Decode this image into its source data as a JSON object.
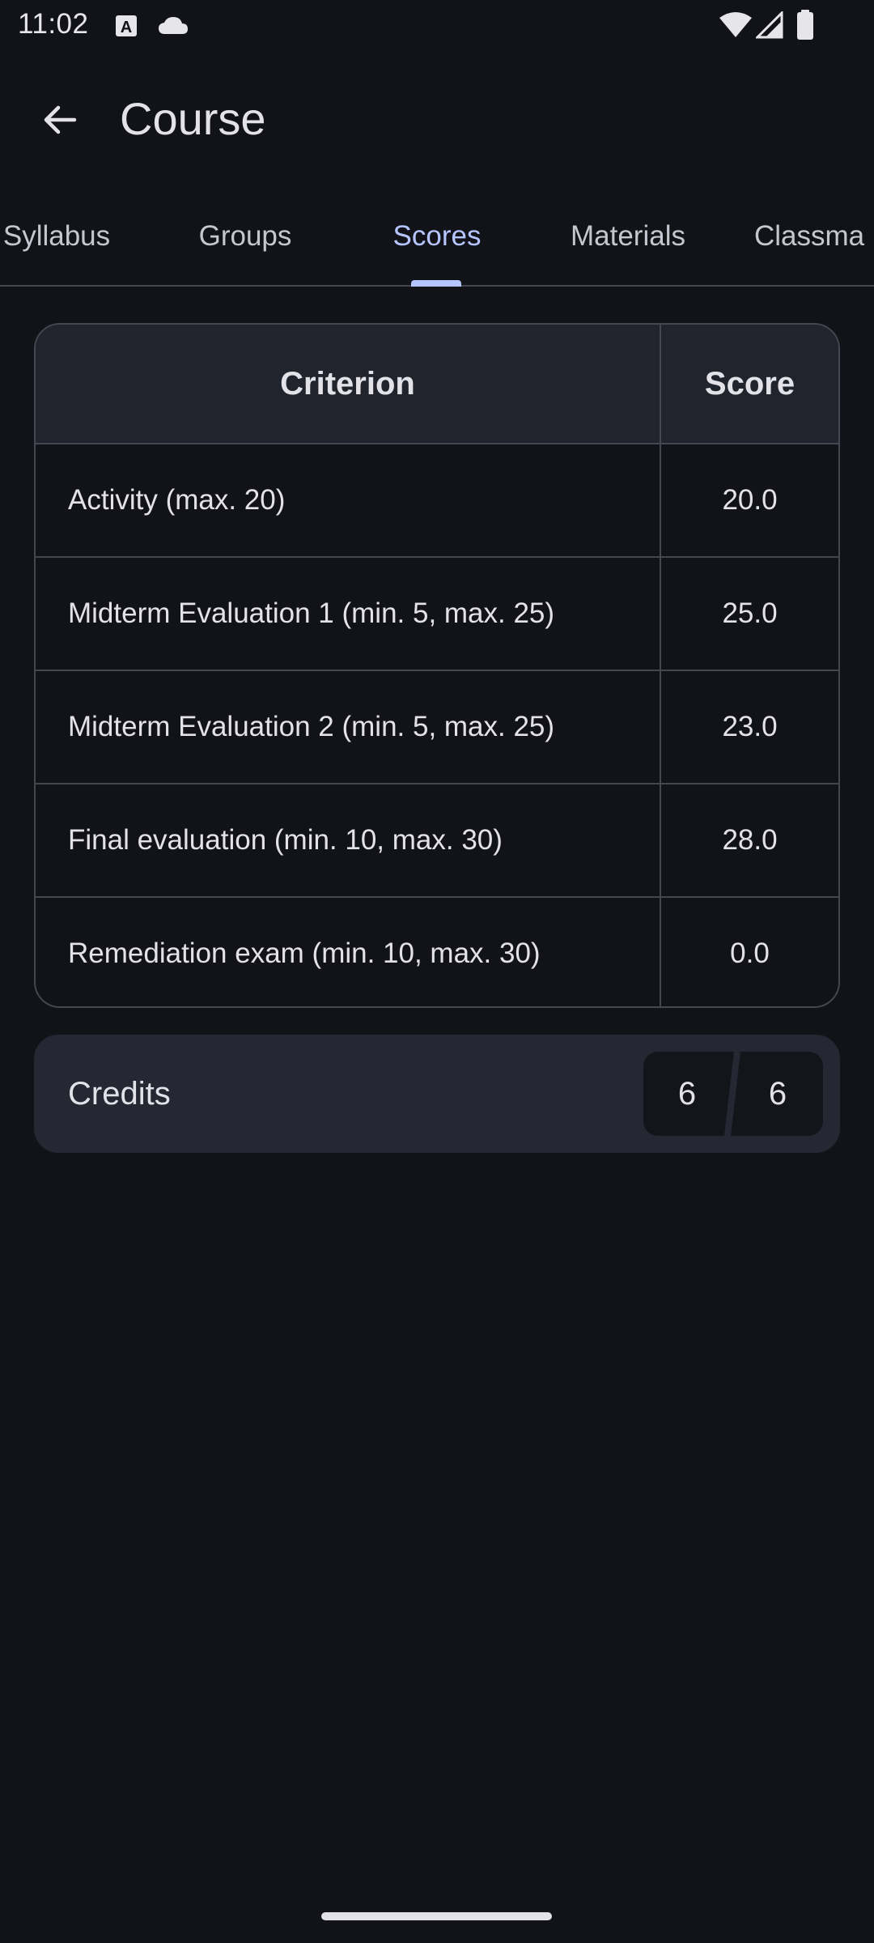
{
  "status_bar": {
    "time": "11:02"
  },
  "app_bar": {
    "title": "Course"
  },
  "tabs": [
    {
      "label": "Syllabus",
      "active": false
    },
    {
      "label": "Groups",
      "active": false
    },
    {
      "label": "Scores",
      "active": true
    },
    {
      "label": "Materials",
      "active": false
    },
    {
      "label": "Classma",
      "active": false
    }
  ],
  "table": {
    "header": {
      "criterion": "Criterion",
      "score": "Score"
    },
    "rows": [
      {
        "criterion": "Activity (max. 20)",
        "score": "20.0"
      },
      {
        "criterion": "Midterm Evaluation 1 (min. 5, max. 25)",
        "score": "25.0"
      },
      {
        "criterion": "Midterm Evaluation 2 (min. 5, max. 25)",
        "score": "23.0"
      },
      {
        "criterion": "Final evaluation (min. 10, max. 30)",
        "score": "28.0"
      },
      {
        "criterion": "Remediation exam (min. 10, max. 30)",
        "score": "0.0"
      }
    ]
  },
  "credits": {
    "label": "Credits",
    "earned": "6",
    "total": "6"
  },
  "colors": {
    "background": "#121318",
    "accent": "#b6c4ff",
    "surface": "#252733",
    "outline": "#45464f"
  }
}
